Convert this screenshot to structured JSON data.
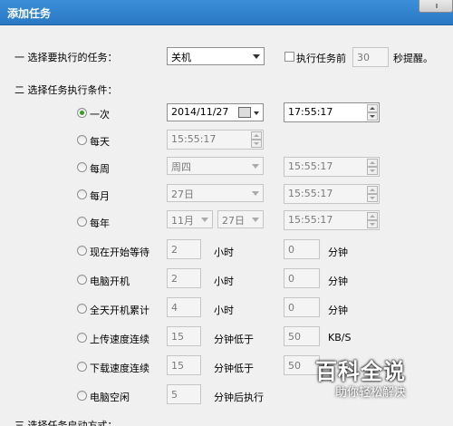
{
  "window": {
    "title": "添加任务"
  },
  "task_section": {
    "label": "一 选择要执行的任务：",
    "selected_task": "关机",
    "remind_checkbox_label": "执行任务前",
    "remind_seconds": "30",
    "remind_suffix": "秒提醒。"
  },
  "condition_section": {
    "label": "二 选择任务执行条件：",
    "once": {
      "label": "一次",
      "date": "2014/11/27",
      "time": "17:55:17"
    },
    "daily": {
      "label": "每天",
      "time": "15:55:17"
    },
    "weekly": {
      "label": "每周",
      "weekday": "周四",
      "time": "15:55:17"
    },
    "monthly": {
      "label": "每月",
      "day": "27日",
      "time": "15:55:17"
    },
    "yearly": {
      "label": "每年",
      "month": "11月",
      "day": "27日",
      "time": "15:55:17"
    },
    "wait_from_now": {
      "label": "现在开始等待",
      "hours": "2",
      "hours_unit": "小时",
      "minutes": "0",
      "minutes_unit": "分钟"
    },
    "after_boot": {
      "label": "电脑开机",
      "hours": "2",
      "hours_unit": "小时",
      "minutes": "0",
      "minutes_unit": "分钟"
    },
    "cumulative_uptime": {
      "label": "全天开机累计",
      "hours": "4",
      "hours_unit": "小时",
      "minutes": "0",
      "minutes_unit": "分钟"
    },
    "upload_speed": {
      "label": "上传速度连续",
      "minutes": "15",
      "minutes_unit": "分钟低于",
      "speed": "50",
      "speed_unit": "KB/S"
    },
    "download_speed": {
      "label": "下载速度连续",
      "minutes": "15",
      "minutes_unit": "分钟低于",
      "speed": "50"
    },
    "idle": {
      "label": "电脑空闲",
      "minutes": "5",
      "minutes_unit": "分钟后执行"
    }
  },
  "start_section": {
    "label": "三 选择任务启动方式："
  },
  "watermark": {
    "big": "百科全说",
    "small": "助你轻松解决"
  }
}
